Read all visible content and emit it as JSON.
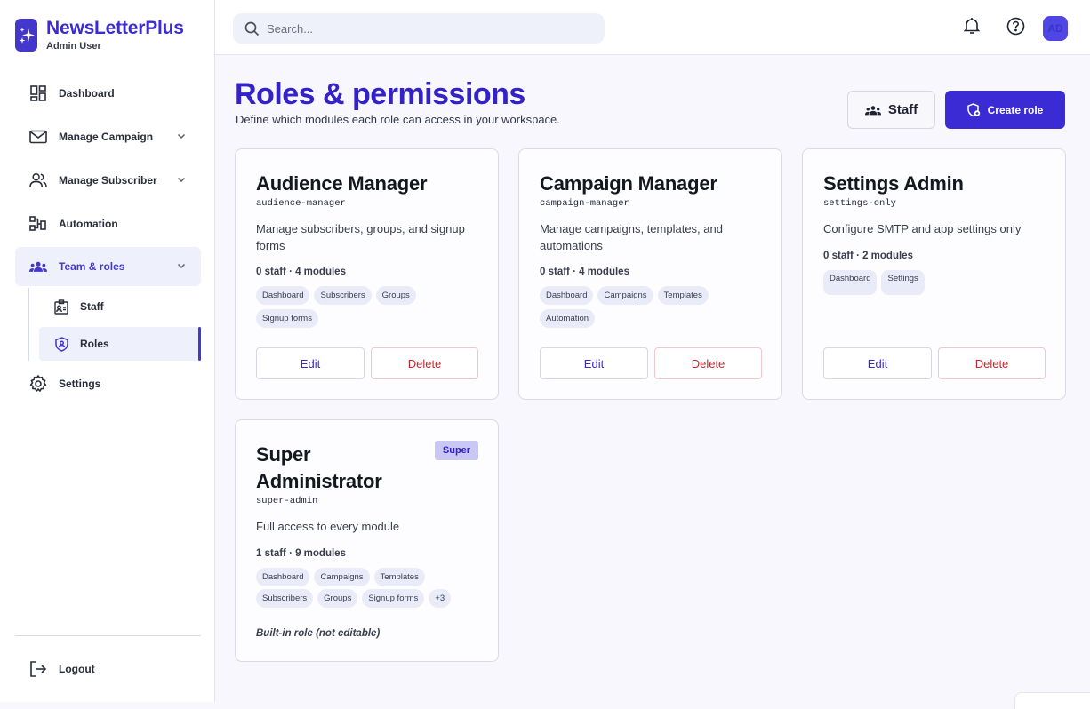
{
  "brand": {
    "name": "NewsLetterPlus",
    "user": "Admin User",
    "accent": "#4338ca"
  },
  "sidebar": {
    "items": [
      {
        "label": "Dashboard",
        "icon": "dashboard-icon"
      },
      {
        "label": "Manage Campaign",
        "icon": "mail-icon"
      },
      {
        "label": "Manage Subscriber",
        "icon": "users-icon"
      },
      {
        "label": "Automation",
        "icon": "automation-icon"
      },
      {
        "label": "Team & roles",
        "icon": "team-icon"
      },
      {
        "label": "Settings",
        "icon": "gear-icon"
      }
    ],
    "subitems": [
      {
        "label": "Staff",
        "icon": "id-badge-icon"
      },
      {
        "label": "Roles",
        "icon": "shield-icon"
      }
    ],
    "logout": "Logout"
  },
  "topbar": {
    "search_placeholder": "Search...",
    "avatar_initials": "AD"
  },
  "page": {
    "title": "Roles & permissions",
    "subtitle": "Define which modules each role can access in your workspace.",
    "staff_button": "Staff",
    "create_button": "Create role"
  },
  "roles": [
    {
      "name": "Audience Manager",
      "slug": "audience-manager",
      "description": "Manage subscribers, groups, and signup forms",
      "meta": "0 staff · 4 modules",
      "modules": [
        "Dashboard",
        "Subscribers",
        "Groups",
        "Signup forms"
      ],
      "edit": "Edit",
      "delete": "Delete"
    },
    {
      "name": "Campaign Manager",
      "slug": "campaign-manager",
      "description": "Manage campaigns, templates, and automations",
      "meta": "0 staff · 4 modules",
      "modules": [
        "Dashboard",
        "Campaigns",
        "Templates",
        "Automation"
      ],
      "edit": "Edit",
      "delete": "Delete"
    },
    {
      "name": "Settings Admin",
      "slug": "settings-only",
      "description": "Configure SMTP and app settings only",
      "meta": "0 staff · 2 modules",
      "modules": [
        "Dashboard",
        "Settings"
      ],
      "edit": "Edit",
      "delete": "Delete"
    },
    {
      "name": "Super Administrator",
      "name_line1": "Super",
      "name_line2": "Administrator",
      "slug": "super-admin",
      "badge": "Super",
      "description": "Full access to every module",
      "meta": "1 staff · 9 modules",
      "modules": [
        "Dashboard",
        "Campaigns",
        "Templates",
        "Subscribers",
        "Groups",
        "Signup forms",
        "+3"
      ],
      "note": "Built-in role (not editable)"
    }
  ]
}
